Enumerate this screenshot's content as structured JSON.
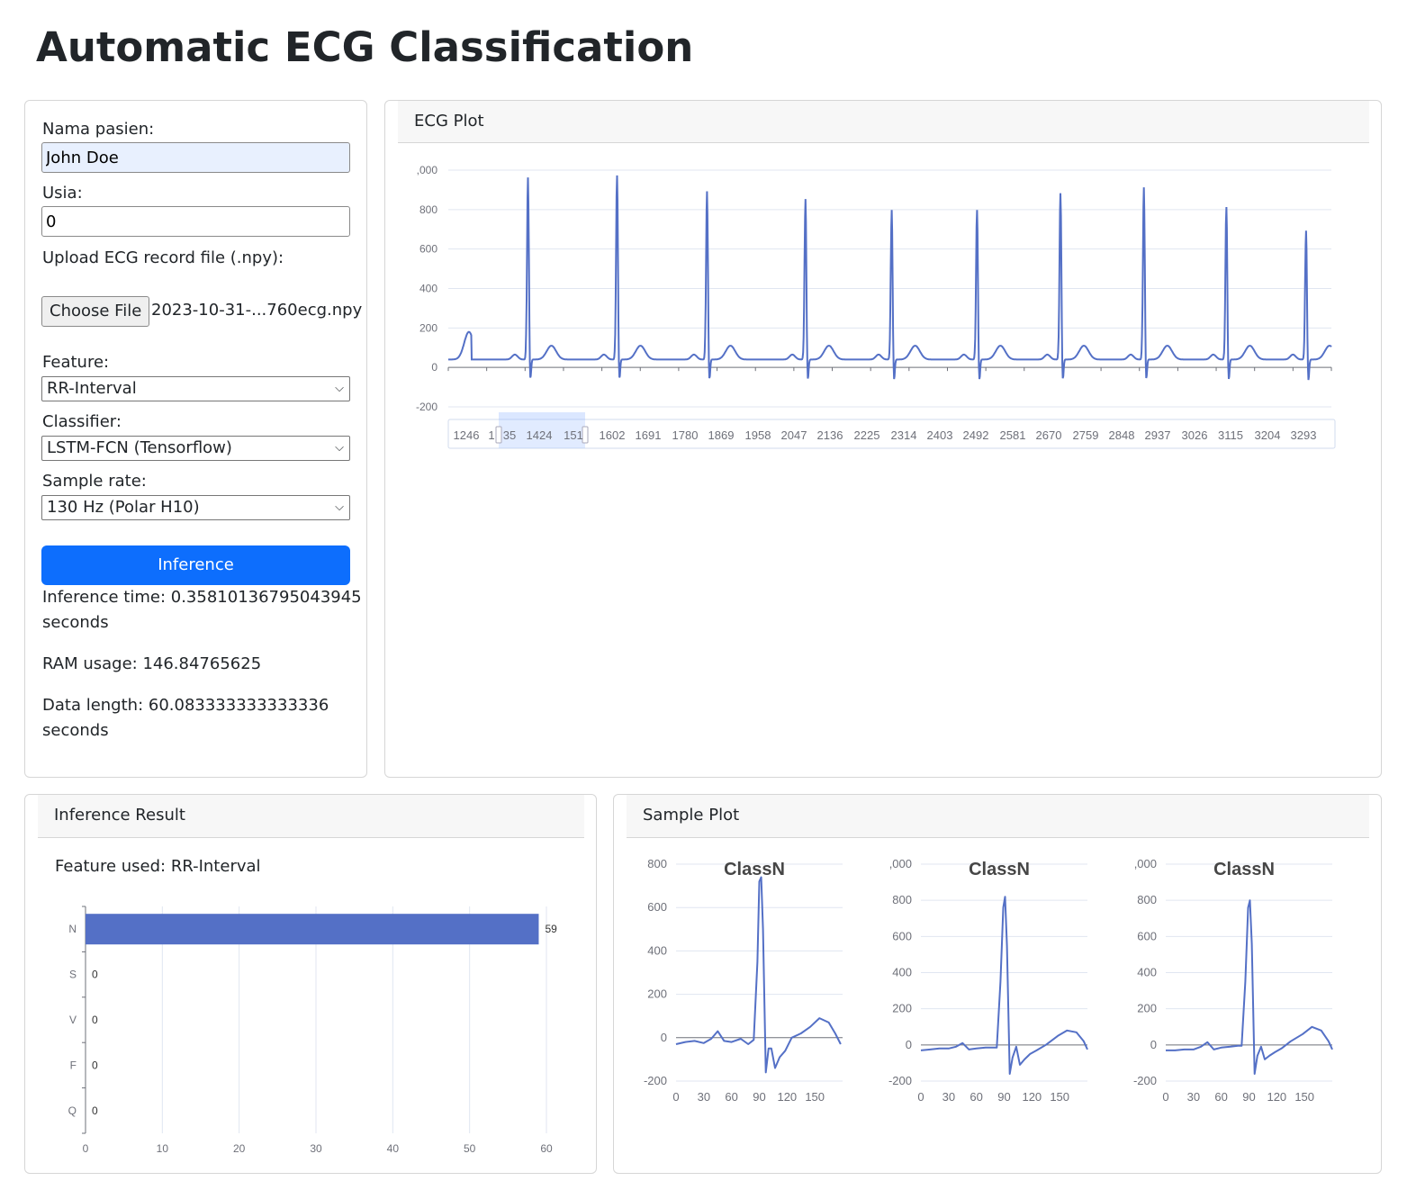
{
  "page": {
    "title": "Automatic ECG Classification"
  },
  "form": {
    "name_label": "Nama pasien:",
    "name_value": "John Doe",
    "age_label": "Usia:",
    "age_value": "0",
    "upload_label": "Upload ECG record file (.npy):",
    "choose_file_label": "Choose File",
    "file_name": "2023-10-31-...760ecg.npy",
    "feature_label": "Feature:",
    "feature_value": "RR-Interval",
    "classifier_label": "Classifier:",
    "classifier_value": "LSTM-FCN (Tensorflow)",
    "sample_rate_label": "Sample rate:",
    "sample_rate_value": "130 Hz (Polar H10)",
    "inference_button": "Inference",
    "inference_time_line1": "Inference time: 0.35810136795043945",
    "inference_time_line2": "seconds",
    "ram_usage": "RAM usage: 146.84765625",
    "data_length_line1": "Data length: 60.083333333333336",
    "data_length_line2": "seconds"
  },
  "icons": {
    "select_caret": "chevron-down-icon"
  },
  "colors": {
    "line": "#5470c6",
    "primary": "#0d6efd"
  },
  "ecg_panel": {
    "header": "ECG Plot"
  },
  "result_panel": {
    "header": "Inference Result",
    "feature_used": "Feature used: RR-Interval"
  },
  "sample_panel": {
    "header": "Sample Plot"
  },
  "chart_data": [
    {
      "type": "line",
      "title": "",
      "y_ticks": [
        ",000",
        "800",
        "600",
        "400",
        "200",
        "0",
        "-200"
      ],
      "ylim": [
        -200,
        1000
      ],
      "x_window": [
        1246,
        3338
      ],
      "r_peaks": [
        {
          "x": 1335,
          "y": 930
        },
        {
          "x": 1396,
          "y": 940
        },
        {
          "x": 1459,
          "y": 860
        },
        {
          "x": 1528,
          "y": 820
        },
        {
          "x": 1588,
          "y": 765
        },
        {
          "x": 1648,
          "y": 765
        },
        {
          "x": 1707,
          "y": 850
        },
        {
          "x": 1766,
          "y": 880
        },
        {
          "x": 1825,
          "y": 780
        },
        {
          "x": 1882,
          "y": 660
        }
      ],
      "slider_labels": [
        "1246",
        "1335",
        "1424",
        "1513",
        "1602",
        "1691",
        "1780",
        "1869",
        "1958",
        "2047",
        "2136",
        "2225",
        "2314",
        "2403",
        "2492",
        "2581",
        "2670",
        "2759",
        "2848",
        "2937",
        "3026",
        "3115",
        "3204",
        "3293"
      ],
      "slider_labels_shown": [
        "1246",
        "1",
        "35",
        "1424",
        "151",
        "1602",
        "1691",
        "1780",
        "1869",
        "1958",
        "2047",
        "2136",
        "2225",
        "2314",
        "2403",
        "2492",
        "2581",
        "2670",
        "2759",
        "2848",
        "2937",
        "3026",
        "3115",
        "3204",
        "3293"
      ],
      "slider_selection": [
        1280,
        1520
      ],
      "grid": true
    },
    {
      "type": "bar",
      "orientation": "horizontal",
      "categories": [
        "N",
        "S",
        "V",
        "F",
        "Q"
      ],
      "values": [
        59,
        0,
        0,
        0,
        0
      ],
      "data_labels": [
        "59",
        "0",
        "0",
        "0",
        "0"
      ],
      "x_ticks": [
        "0",
        "10",
        "20",
        "30",
        "40",
        "50",
        "60"
      ],
      "xlim": [
        0,
        60
      ],
      "grid": true
    },
    {
      "type": "line",
      "title": "ClassN",
      "y_ticks": [
        "800",
        "600",
        "400",
        "200",
        "0",
        "-200"
      ],
      "ylim": [
        -200,
        800
      ],
      "x_ticks": [
        "0",
        "30",
        "60",
        "90",
        "120",
        "150"
      ],
      "xlim": [
        0,
        180
      ],
      "points": [
        [
          0,
          -30
        ],
        [
          10,
          -20
        ],
        [
          20,
          -15
        ],
        [
          30,
          -25
        ],
        [
          38,
          -5
        ],
        [
          45,
          30
        ],
        [
          52,
          -15
        ],
        [
          60,
          -20
        ],
        [
          70,
          -5
        ],
        [
          78,
          -30
        ],
        [
          84,
          -10
        ],
        [
          88,
          350
        ],
        [
          90,
          720
        ],
        [
          92,
          740
        ],
        [
          94,
          500
        ],
        [
          97,
          -160
        ],
        [
          100,
          -50
        ],
        [
          103,
          -50
        ],
        [
          107,
          -140
        ],
        [
          112,
          -90
        ],
        [
          118,
          -60
        ],
        [
          125,
          0
        ],
        [
          135,
          20
        ],
        [
          145,
          50
        ],
        [
          155,
          90
        ],
        [
          165,
          70
        ],
        [
          172,
          20
        ],
        [
          178,
          -30
        ]
      ]
    },
    {
      "type": "line",
      "title": "ClassN",
      "y_ticks": [
        ",000",
        "800",
        "600",
        "400",
        "200",
        "0",
        "-200"
      ],
      "ylim": [
        -200,
        1000
      ],
      "x_ticks": [
        "0",
        "30",
        "60",
        "90",
        "120",
        "150"
      ],
      "xlim": [
        0,
        180
      ],
      "points": [
        [
          0,
          -30
        ],
        [
          10,
          -25
        ],
        [
          20,
          -20
        ],
        [
          30,
          -20
        ],
        [
          38,
          -10
        ],
        [
          45,
          10
        ],
        [
          52,
          -25
        ],
        [
          60,
          -20
        ],
        [
          70,
          -15
        ],
        [
          78,
          -15
        ],
        [
          82,
          -15
        ],
        [
          86,
          350
        ],
        [
          89,
          760
        ],
        [
          91,
          820
        ],
        [
          93,
          550
        ],
        [
          96,
          -160
        ],
        [
          99,
          -70
        ],
        [
          103,
          -10
        ],
        [
          107,
          -110
        ],
        [
          112,
          -80
        ],
        [
          118,
          -50
        ],
        [
          125,
          -30
        ],
        [
          135,
          0
        ],
        [
          148,
          50
        ],
        [
          158,
          80
        ],
        [
          168,
          70
        ],
        [
          176,
          20
        ],
        [
          180,
          -25
        ]
      ]
    },
    {
      "type": "line",
      "title": "ClassN",
      "y_ticks": [
        ",000",
        "800",
        "600",
        "400",
        "200",
        "0",
        "-200"
      ],
      "ylim": [
        -200,
        1000
      ],
      "x_ticks": [
        "0",
        "30",
        "60",
        "90",
        "120",
        "150"
      ],
      "xlim": [
        0,
        180
      ],
      "points": [
        [
          0,
          -30
        ],
        [
          10,
          -30
        ],
        [
          20,
          -25
        ],
        [
          30,
          -25
        ],
        [
          38,
          -10
        ],
        [
          45,
          15
        ],
        [
          52,
          -25
        ],
        [
          60,
          -15
        ],
        [
          70,
          -10
        ],
        [
          78,
          -5
        ],
        [
          82,
          -5
        ],
        [
          86,
          350
        ],
        [
          89,
          760
        ],
        [
          91,
          800
        ],
        [
          93,
          560
        ],
        [
          96,
          -160
        ],
        [
          99,
          -60
        ],
        [
          103,
          -10
        ],
        [
          107,
          -80
        ],
        [
          112,
          -60
        ],
        [
          118,
          -40
        ],
        [
          125,
          -20
        ],
        [
          135,
          20
        ],
        [
          148,
          60
        ],
        [
          158,
          100
        ],
        [
          168,
          80
        ],
        [
          176,
          20
        ],
        [
          180,
          -25
        ]
      ]
    }
  ]
}
